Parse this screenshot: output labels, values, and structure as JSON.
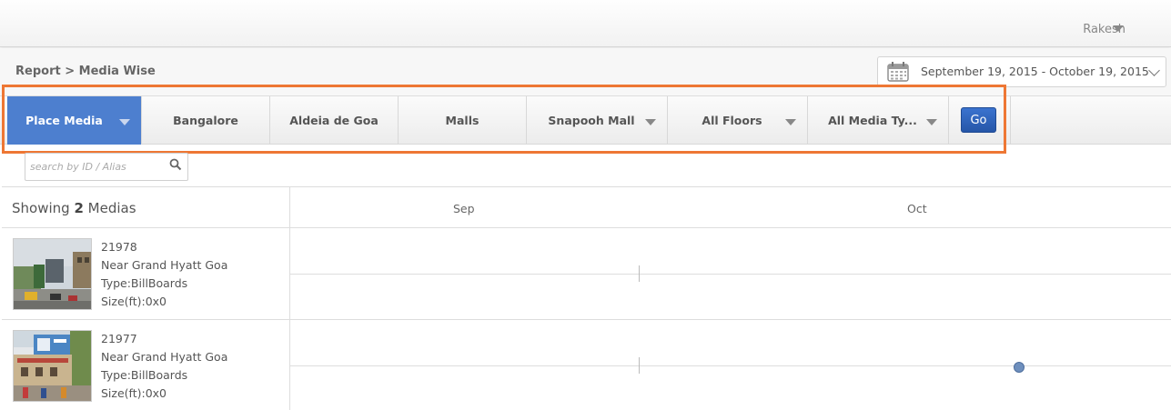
{
  "header": {
    "user_name": "Rakesh"
  },
  "subheader": {
    "breadcrumb": "Report > Media Wise",
    "date_range": "September 19, 2015 - October 19, 2015"
  },
  "filters": {
    "items": [
      {
        "label": "Place Media",
        "active": true,
        "dropdown": true
      },
      {
        "label": "Bangalore",
        "dropdown": false
      },
      {
        "label": "Aldeia de Goa",
        "dropdown": false
      },
      {
        "label": "Malls",
        "dropdown": false
      },
      {
        "label": "Snapooh Mall",
        "dropdown": true
      },
      {
        "label": "All Floors",
        "dropdown": true
      },
      {
        "label": "All Media Ty...",
        "dropdown": true
      }
    ],
    "go_label": "Go",
    "highlight_color": "#ee7734"
  },
  "search": {
    "placeholder": "search by ID / Alias",
    "value": ""
  },
  "table": {
    "showing_prefix": "Showing",
    "showing_count": "2",
    "showing_suffix": "Medias",
    "months": [
      "Sep",
      "Oct"
    ],
    "rows": [
      {
        "id": "21978",
        "location": "Near Grand Hyatt Goa",
        "type": "Type:BillBoards",
        "size": "Size(ft):0x0"
      },
      {
        "id": "21977",
        "location": "Near Grand Hyatt Goa",
        "type": "Type:BillBoards",
        "size": "Size(ft):0x0"
      }
    ]
  },
  "colors": {
    "accent": "#4d7fcf",
    "go_button": "#2b60b8",
    "timeline_dot": "#6e8fbd"
  }
}
